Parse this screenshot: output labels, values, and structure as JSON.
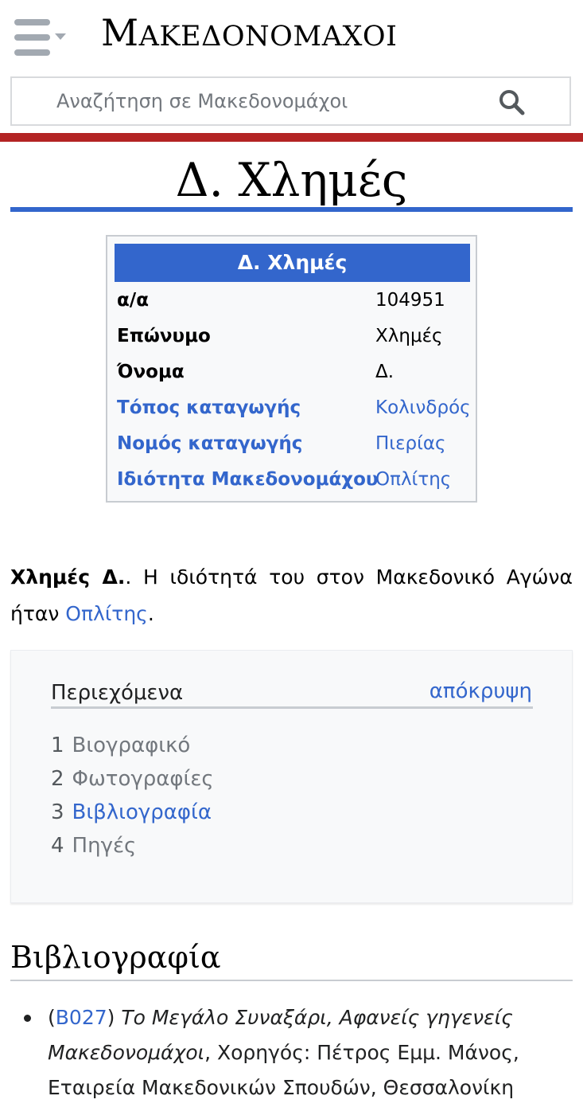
{
  "header": {
    "logo_first": "M",
    "logo_rest": "ΑΚΕΔΟΝΟΜΑΧΟΙ",
    "search_placeholder": "Αναζήτηση σε Μακεδονομάχοι"
  },
  "page": {
    "title": "Δ. Χλημές"
  },
  "infobox": {
    "heading": "Δ. Χλημές",
    "rows": [
      {
        "label": "α/α",
        "value": "104951"
      },
      {
        "label": "Επώνυμο",
        "value": "Χλημές"
      },
      {
        "label": "Όνομα",
        "value": "Δ."
      },
      {
        "label": "Τόπος καταγωγής",
        "value": "Κολινδρός"
      },
      {
        "label": "Νομός καταγωγής",
        "value": "Πιερίας"
      },
      {
        "label": "Ιδιότητα Μακεδονομάχου",
        "value": "Οπλίτης"
      }
    ]
  },
  "lead": {
    "name": "Χλημές Δ.",
    "text": ". Η ιδιότητά του στον Μακεδονικό Αγώνα ήταν ",
    "link": "Οπλίτης",
    "end": "."
  },
  "toc": {
    "title": "Περιεχόμενα",
    "toggle": "απόκρυψη",
    "items": [
      {
        "num": "1",
        "label": "Βιογραφικό"
      },
      {
        "num": "2",
        "label": "Φωτογραφίες"
      },
      {
        "num": "3",
        "label": "Βιβλιογραφία"
      },
      {
        "num": "4",
        "label": "Πηγές"
      }
    ]
  },
  "section": {
    "heading": "Βιβλιογραφία",
    "ref": {
      "open": "(",
      "code": "B027",
      "close": ") ",
      "title": "Το Μεγάλο Συναξάρι, Αφανείς γηγενείς Μακεδονομάχοι",
      "rest": ", Χορηγός: Πέτρος Εμμ. Μάνος, Εταιρεία Μακεδονικών Σπουδών, Θεσσαλονίκη"
    }
  },
  "colors": {
    "link": "#3366cc",
    "accent_red": "#b32424",
    "infobox_header": "#3366cc"
  }
}
